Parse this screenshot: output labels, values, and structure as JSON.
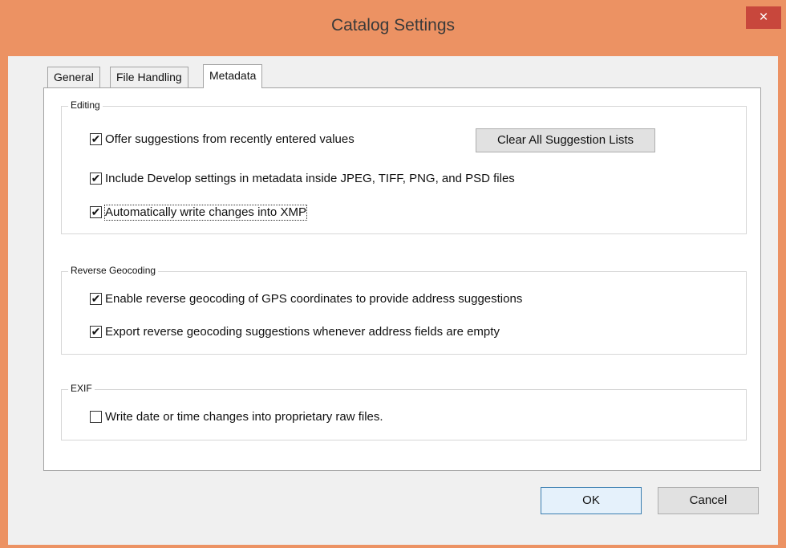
{
  "window": {
    "title": "Catalog Settings",
    "close_symbol": "×"
  },
  "tabs": [
    {
      "label": "General",
      "active": false
    },
    {
      "label": "File Handling",
      "active": false
    },
    {
      "label": "Metadata",
      "active": true
    }
  ],
  "editing": {
    "label": "Editing",
    "offer_suggestions": {
      "label": "Offer suggestions from recently entered values",
      "checked": true
    },
    "clear_button": "Clear All Suggestion Lists",
    "include_develop": {
      "label": "Include Develop settings in metadata inside JPEG, TIFF, PNG, and PSD files",
      "checked": true
    },
    "auto_write_xmp": {
      "label": "Automatically write changes into XMP",
      "checked": true
    }
  },
  "reverse_geocoding": {
    "label": "Reverse Geocoding",
    "enable": {
      "label": "Enable reverse geocoding of GPS coordinates to provide address suggestions",
      "checked": true
    },
    "export": {
      "label": "Export reverse geocoding suggestions whenever address fields are empty",
      "checked": true
    }
  },
  "exif": {
    "label": "EXIF",
    "write_date_time": {
      "label": "Write date or time changes into proprietary raw files.",
      "checked": false
    }
  },
  "footer": {
    "ok": "OK",
    "cancel": "Cancel"
  },
  "check_mark": "✔"
}
